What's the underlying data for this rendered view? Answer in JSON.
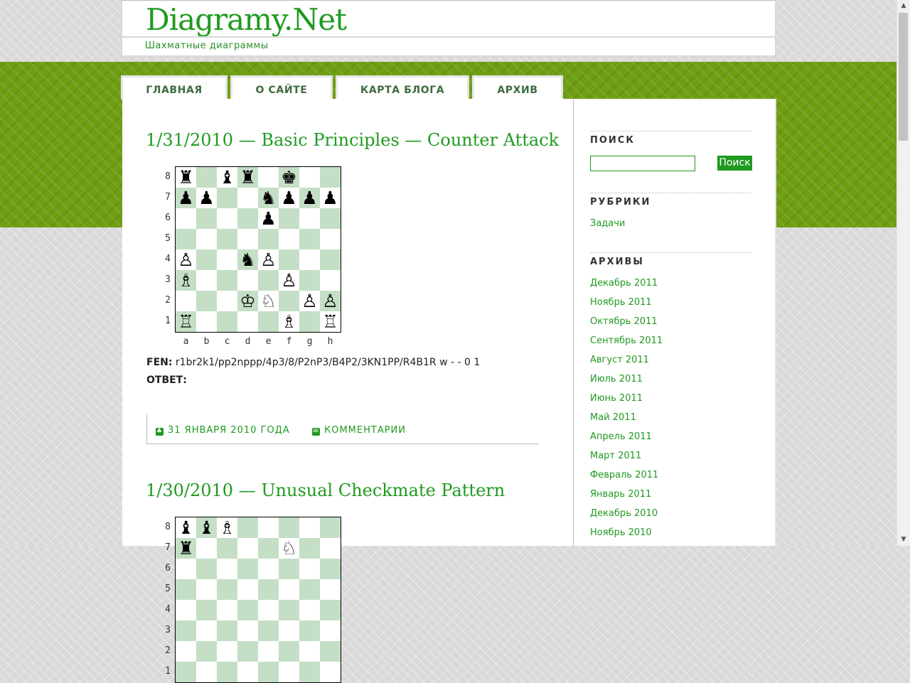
{
  "site": {
    "title": "Diagramy.Net",
    "description": "Шахматные диаграммы"
  },
  "nav": [
    "ГЛАВНАЯ",
    "О САЙТЕ",
    "КАРТА БЛОГА",
    "АРХИВ"
  ],
  "posts": [
    {
      "title": "1/31/2010 — Basic Principles — Counter Attack",
      "board": [
        "r.br.k..",
        "pp..nppp",
        "....p...",
        "........",
        "P..nP...",
        "B....P..",
        "...KN.PP",
        "R....B.R"
      ],
      "fen_label": "FEN:",
      "fen": "r1br2k1/pp2nppp/4p3/8/P2nP3/B4P2/3KN1PP/R4B1R w - - 0 1",
      "answer_label": "ОТВЕТ:",
      "date": "31 ЯНВАРЯ 2010 ГОДА",
      "comments": "КОММЕНТАРИИ"
    },
    {
      "title": "1/30/2010 — Unusual Checkmate Pattern",
      "board": [
        "bbB.....",
        "r....N..."
      ]
    }
  ],
  "files": [
    "a",
    "b",
    "c",
    "d",
    "e",
    "f",
    "g",
    "h"
  ],
  "ranks": [
    "8",
    "7",
    "6",
    "5",
    "4",
    "3",
    "2",
    "1"
  ],
  "sidebar": {
    "search_title": "ПОИСК",
    "search_button": "Поиск",
    "search_value": "",
    "categories_title": "РУБРИКИ",
    "categories": [
      "Задачи"
    ],
    "archives_title": "АРХИВЫ",
    "archives": [
      "Декабрь 2011",
      "Ноябрь 2011",
      "Октябрь 2011",
      "Сентябрь 2011",
      "Август 2011",
      "Июль 2011",
      "Июнь 2011",
      "Май 2011",
      "Апрель 2011",
      "Март 2011",
      "Февраль 2011",
      "Январь 2011",
      "Декабрь 2010",
      "Ноябрь 2010"
    ]
  },
  "colors": {
    "accent": "#1f9a1f",
    "band": "#6e9e12",
    "dark_square": "#c4dfc5"
  },
  "icons": {
    "date": "leaf-icon",
    "comments": "speech-bubble-icon",
    "scroll_up": "triangle-up-icon",
    "scroll_down": "triangle-down-icon"
  }
}
